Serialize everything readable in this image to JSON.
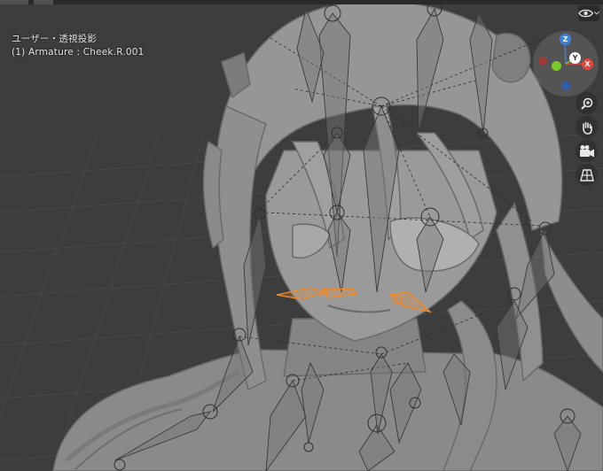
{
  "viewport": {
    "view_mode": "ユーザー・透視投影",
    "active_object": "(1) Armature : Cheek.R.001"
  },
  "gizmo": {
    "axis_z": "Z",
    "axis_y": "Y",
    "axis_x": "X"
  },
  "colors": {
    "background": "#3d3d3d",
    "model": "#8c8c8c",
    "bone_selected": "#f08a2a",
    "axis_x": "#e0453f",
    "axis_y": "#7bc62d",
    "axis_z": "#3f80d8"
  },
  "icons": {
    "visibility": "eye-icon",
    "zoom": "zoom-in-icon",
    "pan": "hand-icon",
    "camera": "camera-icon",
    "ortho": "grid-icon"
  }
}
